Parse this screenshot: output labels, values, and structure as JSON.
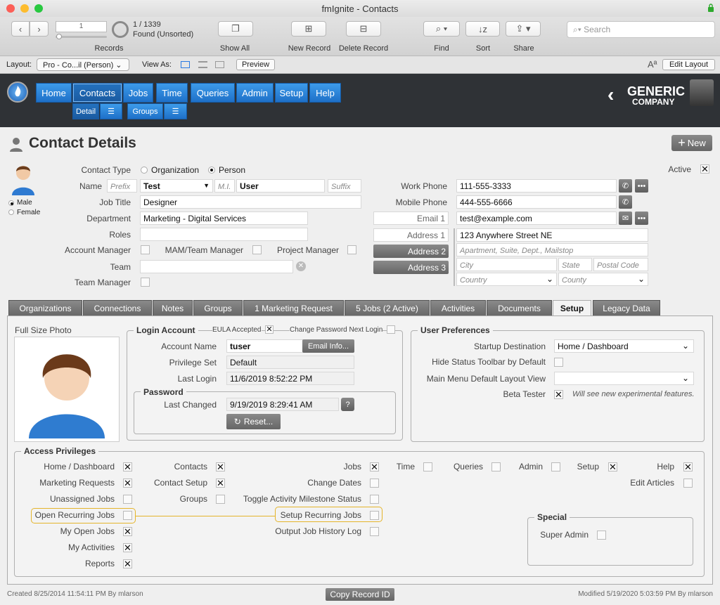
{
  "window": {
    "title": "fmIgnite - Contacts"
  },
  "toolbar": {
    "record_num": "1",
    "record_count": "1 / 1339",
    "found_status": "Found (Unsorted)",
    "records_label": "Records",
    "show_all": "Show All",
    "new_record": "New Record",
    "delete_record": "Delete Record",
    "find": "Find",
    "sort": "Sort",
    "share": "Share",
    "search_placeholder": "Search"
  },
  "layoutbar": {
    "layout_label": "Layout:",
    "layout_value": "Pro - Co...il (Person)",
    "view_as": "View As:",
    "preview": "Preview",
    "edit_layout": "Edit Layout"
  },
  "nav": {
    "items": [
      "Home",
      "Contacts",
      "Jobs",
      "Time",
      "Queries",
      "Admin",
      "Setup",
      "Help"
    ],
    "sub": {
      "detail": "Detail",
      "groups": "Groups"
    },
    "brand_line1": "GENERIC",
    "brand_line2": "COMPANY"
  },
  "page": {
    "title": "Contact Details",
    "new_button": "New"
  },
  "contact": {
    "contact_type_label": "Contact Type",
    "opt_org": "Organization",
    "opt_person": "Person",
    "name_label": "Name",
    "prefix_ph": "Prefix",
    "first": "Test",
    "mi_ph": "M.I.",
    "last": "User",
    "suffix_ph": "Suffix",
    "job_title_label": "Job Title",
    "job_title": "Designer",
    "department_label": "Department",
    "department": "Marketing - Digital Services",
    "roles_label": "Roles",
    "account_manager": "Account Manager",
    "mam": "MAM/Team Manager",
    "project_manager": "Project Manager",
    "team_label": "Team",
    "team_manager_label": "Team Manager",
    "gender_male": "Male",
    "gender_female": "Female",
    "active_label": "Active",
    "active_mark": "✕",
    "work_phone_label": "Work Phone",
    "work_phone": "111-555-3333",
    "mobile_phone_label": "Mobile Phone",
    "mobile_phone": "444-555-6666",
    "email_label": "Email 1",
    "email": "test@example.com",
    "address1_btn": "Address 1",
    "address2_btn": "Address 2",
    "address3_btn": "Address 3",
    "street": "123 Anywhere Street NE",
    "street2_ph": "Apartment, Suite, Dept., Mailstop",
    "city_ph": "City",
    "state_ph": "State",
    "postal_ph": "Postal Code",
    "country_ph": "Country",
    "county_ph": "County"
  },
  "tabs": [
    "Organizations",
    "Connections",
    "Notes",
    "Groups",
    "1 Marketing Request",
    "5 Jobs (2 Active)",
    "Activities",
    "Documents",
    "Setup",
    "Legacy Data"
  ],
  "setup": {
    "photo_label": "Full Size Photo",
    "login_title": "Login Account",
    "eula": "EULA Accepted",
    "eula_mark": "✕",
    "change_pw": "Change Password Next Login",
    "account_name_label": "Account Name",
    "account_name": "tuser",
    "email_info": "Email Info...",
    "privilege_set_label": "Privilege Set",
    "privilege_set": "Default",
    "last_login_label": "Last Login",
    "last_login": "11/6/2019 8:52:22 PM",
    "password_title": "Password",
    "last_changed_label": "Last Changed",
    "last_changed": "9/19/2019 8:29:41 AM",
    "reset": "Reset...",
    "prefs_title": "User Preferences",
    "startup_label": "Startup Destination",
    "startup": "Home / Dashboard",
    "hide_toolbar_label": "Hide Status Toolbar by Default",
    "main_menu_label": "Main Menu Default Layout View",
    "beta_label": "Beta Tester",
    "beta_mark": "✕",
    "beta_note": "Will see new experimental features."
  },
  "access": {
    "title": "Access Privileges",
    "items": [
      {
        "label": "Home / Dashboard",
        "checked": true
      },
      {
        "label": "Marketing Requests",
        "checked": true
      },
      {
        "label": "Unassigned Jobs",
        "checked": false
      },
      {
        "label": "Open Recurring Jobs",
        "checked": false
      },
      {
        "label": "My Open Jobs",
        "checked": true
      },
      {
        "label": "My Activities",
        "checked": true
      },
      {
        "label": "Reports",
        "checked": true
      },
      {
        "label": "Contacts",
        "checked": true
      },
      {
        "label": "Contact Setup",
        "checked": true
      },
      {
        "label": "Groups",
        "checked": false
      },
      {
        "label": "Jobs",
        "checked": true
      },
      {
        "label": "Change Dates",
        "checked": false
      },
      {
        "label": "Toggle Activity Milestone Status",
        "checked": false
      },
      {
        "label": "Setup Recurring Jobs",
        "checked": false
      },
      {
        "label": "Output Job History Log",
        "checked": false
      },
      {
        "label": "Time",
        "checked": false
      },
      {
        "label": "Queries",
        "checked": false
      },
      {
        "label": "Admin",
        "checked": false
      },
      {
        "label": "Setup",
        "checked": true
      },
      {
        "label": "Help",
        "checked": true
      },
      {
        "label": "Edit Articles",
        "checked": false
      }
    ],
    "special_title": "Special",
    "super_admin": "Super Admin"
  },
  "footer": {
    "created": "Created 8/25/2014 11:54:11 PM By mlarson",
    "copy_id": "Copy Record ID",
    "modified": "Modified 5/19/2020 5:03:59 PM By mlarson"
  }
}
